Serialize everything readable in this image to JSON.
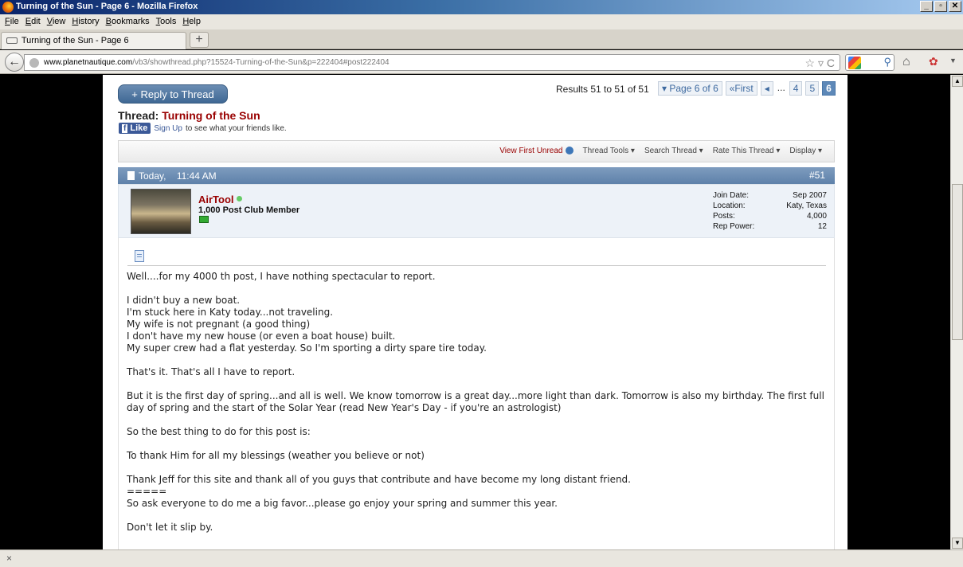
{
  "window": {
    "title": "Turning of the Sun - Page 6 - Mozilla Firefox",
    "controls": [
      "_",
      "▫",
      "✕"
    ]
  },
  "menu": [
    "File",
    "Edit",
    "View",
    "History",
    "Bookmarks",
    "Tools",
    "Help"
  ],
  "tab": {
    "label": "Turning of the Sun - Page 6",
    "new_tab": "+"
  },
  "nav": {
    "url_domain": "www.planetnautique.com",
    "url_path": "/vb3/showthread.php?15524-Turning-of-the-Sun&p=222404#post222404",
    "url_icons": "☆ ▿ C",
    "search_placeholder": "G"
  },
  "thread": {
    "reply_button": "+ Reply to Thread",
    "results": "Results 51 to 51 of 51",
    "pages": {
      "label": "▾ Page 6 of 6",
      "first": "«First",
      "prev": "◂",
      "dots": "...",
      "p4": "4",
      "p5": "5",
      "p6": "6"
    },
    "title_prefix": "Thread:",
    "title": "Turning of the Sun",
    "fb_like": "Like",
    "fb_signup": "Sign Up",
    "fb_text": "to see what your friends like.",
    "tools": {
      "view_first_unread": "View First Unread",
      "thread_tools": "Thread Tools ▾",
      "search_thread": "Search Thread ▾",
      "rate_thread": "Rate This Thread ▾",
      "display": "Display ▾"
    }
  },
  "post": {
    "date": "Today,",
    "time": "11:44 AM",
    "number": "#51",
    "user": {
      "name": "AirTool",
      "title": "1,000 Post Club Member",
      "stats": [
        {
          "label": "Join Date:",
          "value": "Sep 2007"
        },
        {
          "label": "Location:",
          "value": "Katy, Texas"
        },
        {
          "label": "Posts:",
          "value": "4,000"
        },
        {
          "label": "Rep Power:",
          "value": "12"
        }
      ]
    },
    "body": [
      "Well....for my 4000 th post, I have nothing spectacular to report.",
      "I didn't buy a new boat.\nI'm stuck here in Katy today...not traveling.\nMy wife is not pregnant (a good thing)\nI don't have my new house (or even a boat house) built.\nMy super crew had a flat yesterday. So I'm sporting a dirty spare tire today.",
      "That's it. That's all I have to report.",
      "But it is the first day of spring...and all is well. We know tomorrow is a great day...more light than dark. Tomorrow is also my birthday. The first full day of spring and the start of the Solar Year (read New Year's Day - if you're an astrologist)",
      "So the best thing to do for this post is:",
      "To thank Him for all my blessings (weather you believe or not)",
      "Thank Jeff for this site and thank all of you guys that contribute and have become my long distant friend.\n=====\nSo ask everyone to do me a big favor...please go enjoy your spring and summer this year.",
      "Don't let it slip by."
    ]
  },
  "status": {
    "close": "×"
  }
}
